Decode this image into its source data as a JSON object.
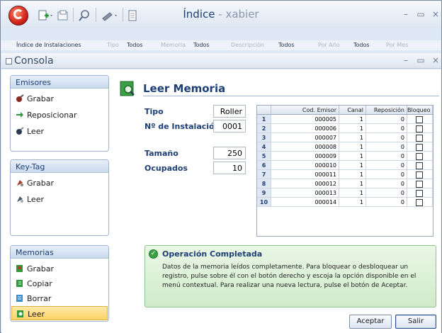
{
  "window": {
    "title": "Índice",
    "subtitle": "- xabier"
  },
  "ribbon": {
    "items": [
      "Índice de Instalaciones",
      "Tipo",
      "Todos",
      "Memoria",
      "Todos",
      "Descripción",
      "Todos",
      "Por Año",
      "Todos",
      "Por Mes"
    ]
  },
  "child_window": {
    "title": "Consola"
  },
  "sidebar": {
    "emisores": {
      "header": "Emisores",
      "items": [
        {
          "label": "Grabar",
          "icon": "key-record-icon"
        },
        {
          "label": "Reposicionar",
          "icon": "reposition-arrow-icon"
        },
        {
          "label": "Leer",
          "icon": "key-read-icon"
        }
      ]
    },
    "keytag": {
      "header": "Key-Tag",
      "items": [
        {
          "label": "Grabar",
          "icon": "keytag-record-icon"
        },
        {
          "label": "Leer",
          "icon": "keytag-read-icon"
        }
      ]
    },
    "memorias": {
      "header": "Memorias",
      "items": [
        {
          "label": "Grabar",
          "icon": "memory-record-icon"
        },
        {
          "label": "Copiar",
          "icon": "memory-copy-icon"
        },
        {
          "label": "Borrar",
          "icon": "memory-erase-icon"
        },
        {
          "label": "Leer",
          "icon": "memory-read-icon",
          "selected": true
        }
      ]
    }
  },
  "main": {
    "heading": "Leer Memoria",
    "fields": {
      "tipo_label": "Tipo",
      "tipo_value": "Roller",
      "instalacion_label": "Nº de Instalación",
      "instalacion_value": "0001",
      "tamano_label": "Tamaño",
      "tamano_value": "250",
      "ocupados_label": "Ocupados",
      "ocupados_value": "10"
    },
    "grid": {
      "columns": [
        "Cod. Emisor",
        "Canal",
        "Reposición",
        "Bloqueo"
      ],
      "rows": [
        {
          "n": "1",
          "cod": "000005",
          "canal": "1",
          "repos": "0"
        },
        {
          "n": "2",
          "cod": "000006",
          "canal": "1",
          "repos": "0"
        },
        {
          "n": "3",
          "cod": "000007",
          "canal": "1",
          "repos": "0"
        },
        {
          "n": "4",
          "cod": "000008",
          "canal": "1",
          "repos": "0"
        },
        {
          "n": "5",
          "cod": "000009",
          "canal": "1",
          "repos": "0"
        },
        {
          "n": "6",
          "cod": "000010",
          "canal": "1",
          "repos": "0"
        },
        {
          "n": "7",
          "cod": "000011",
          "canal": "1",
          "repos": "0"
        },
        {
          "n": "8",
          "cod": "000012",
          "canal": "1",
          "repos": "0"
        },
        {
          "n": "9",
          "cod": "000013",
          "canal": "1",
          "repos": "0"
        },
        {
          "n": "10",
          "cod": "000014",
          "canal": "1",
          "repos": "0"
        }
      ]
    },
    "info": {
      "title": "Operación Completada",
      "text": "Datos de la memoria leídos completamente. Para bloquear o desbloquear un registro, pulse sobre él con el botón derecho y escoja la opción disponible en el menú contextual. Para realizar una nueva lectura, pulse el botón de Aceptar."
    },
    "buttons": {
      "accept": "Aceptar",
      "exit": "Salir"
    }
  },
  "colors": {
    "accent": "#1e3f73",
    "selected": "#ffd466",
    "success": "#d0ebc9"
  }
}
